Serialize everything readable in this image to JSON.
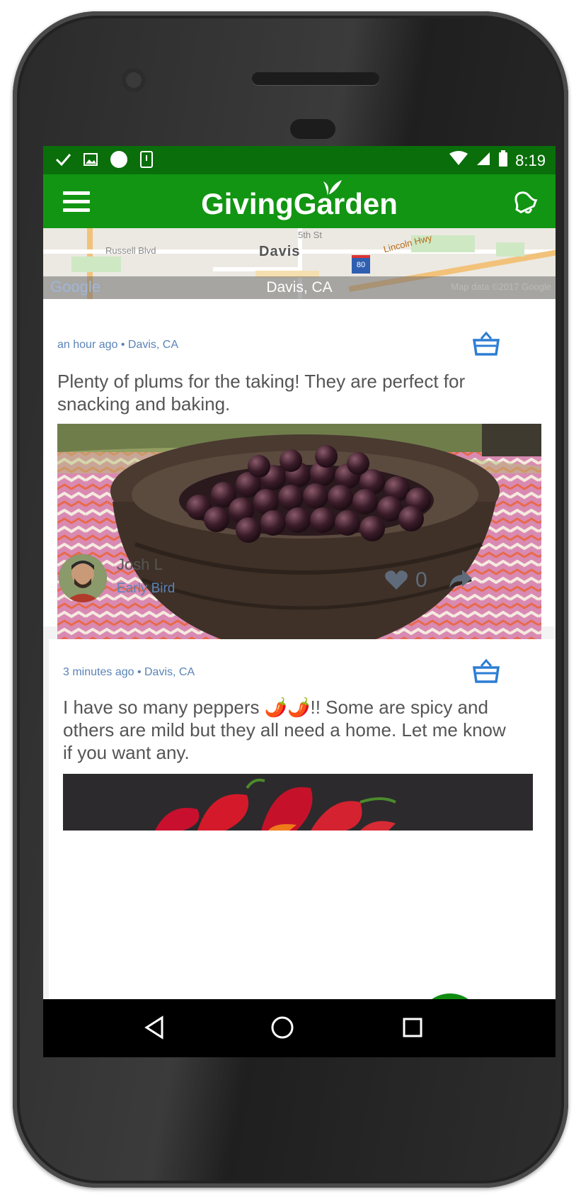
{
  "status_bar": {
    "time": "8:19"
  },
  "app_bar": {
    "title": "GivingGarden"
  },
  "map": {
    "city_label": "Davis",
    "location": "Davis, CA",
    "streets": [
      "Russell Blvd",
      "5th St",
      "Lincoln Hwy"
    ],
    "highway_shield": "80",
    "logo": "Google",
    "attribution": "Map data ©2017 Google"
  },
  "posts": [
    {
      "meta": "an hour ago • Davis, CA",
      "text": "Plenty of plums for the taking! They are perfect for snacking and baking.",
      "author": "Josh L",
      "badge": "Early Bird",
      "likes": "0"
    },
    {
      "meta": "3 minutes ago • Davis, CA",
      "text": "I have so many peppers 🌶️🌶️!! Some are spicy and others are mild but they all need a home. Let me know if you want any."
    }
  ],
  "fab": {
    "label": "+"
  },
  "colors": {
    "primary": "#129512",
    "status_bar": "#0a6e0a",
    "accent_text": "#5a83b8",
    "fab": "#0f8c0f"
  },
  "icons": [
    "menu-icon",
    "leaf-icon",
    "bell-icon",
    "basket-icon",
    "heart-icon",
    "share-icon",
    "back-icon",
    "home-icon",
    "recents-icon"
  ]
}
